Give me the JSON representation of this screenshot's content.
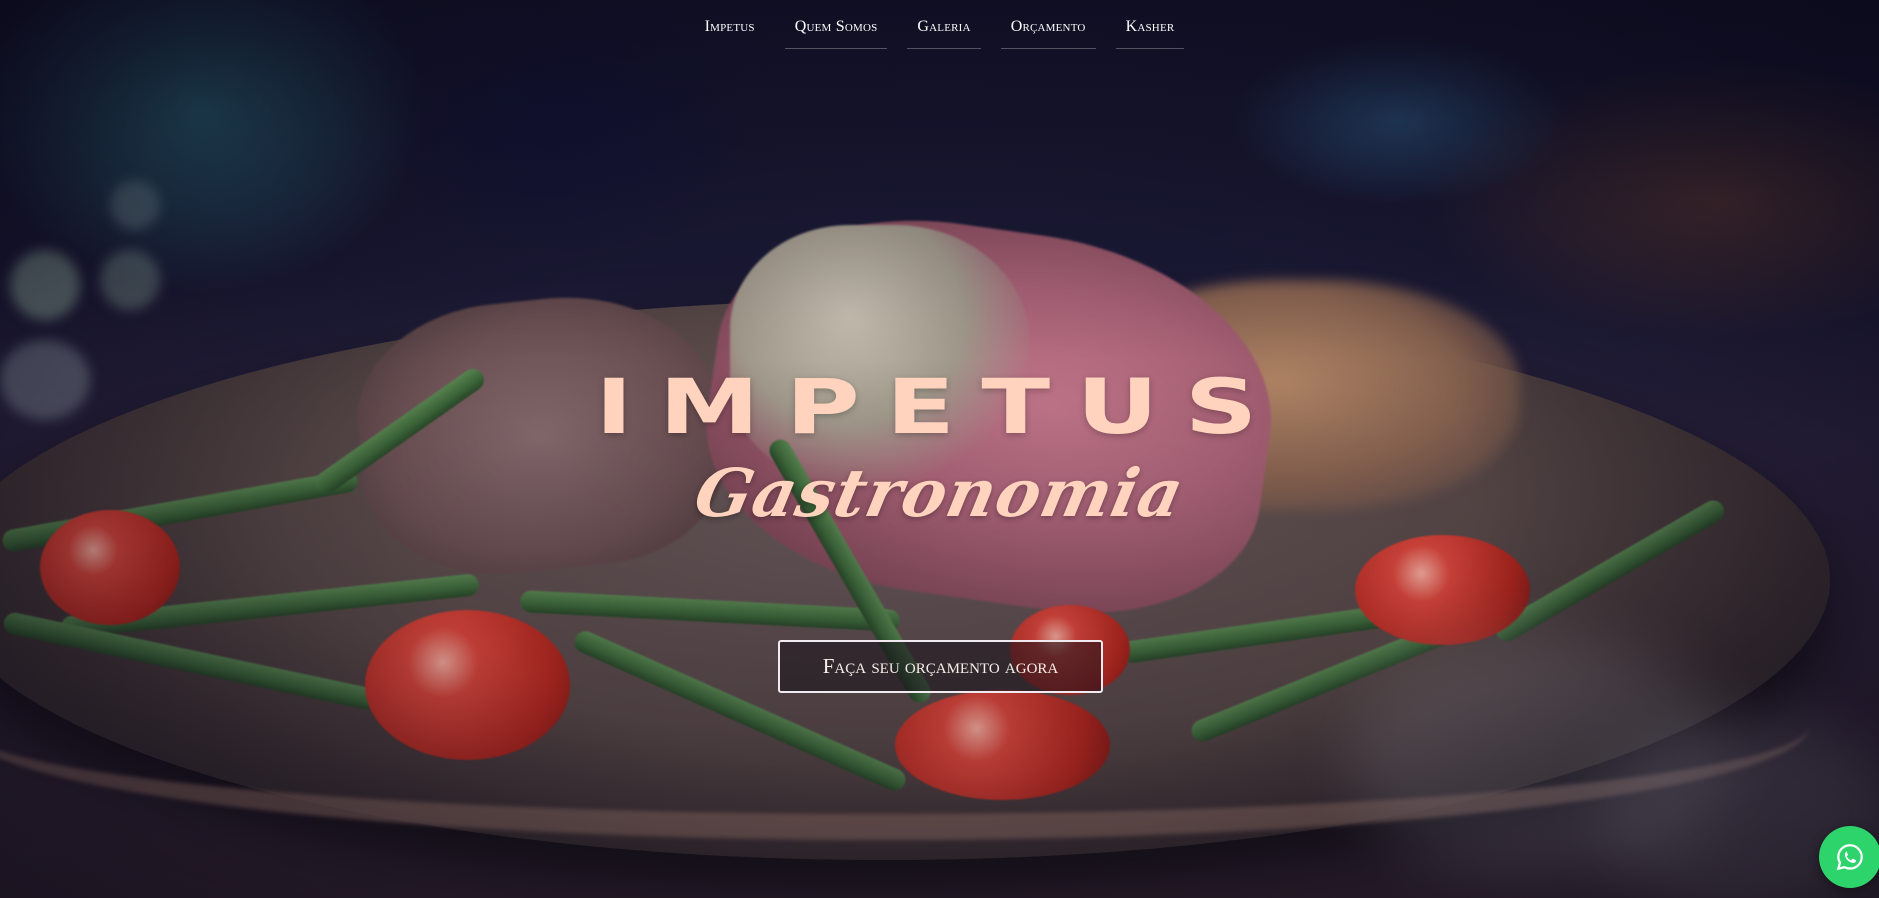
{
  "nav": {
    "items": [
      {
        "label": "Impetus"
      },
      {
        "label": "Quem Somos"
      },
      {
        "label": "Galeria"
      },
      {
        "label": "Orçamento"
      },
      {
        "label": "Kasher"
      }
    ]
  },
  "hero": {
    "title": "IMPETUS",
    "subtitle": "Gastronomia",
    "cta_label": "Faça seu orçamento agora"
  },
  "floating": {
    "whatsapp_icon": "whatsapp-icon"
  },
  "colors": {
    "title": "#ffd3be",
    "whatsapp": "#2cd46b",
    "cta_border": "#f1eaf0"
  }
}
